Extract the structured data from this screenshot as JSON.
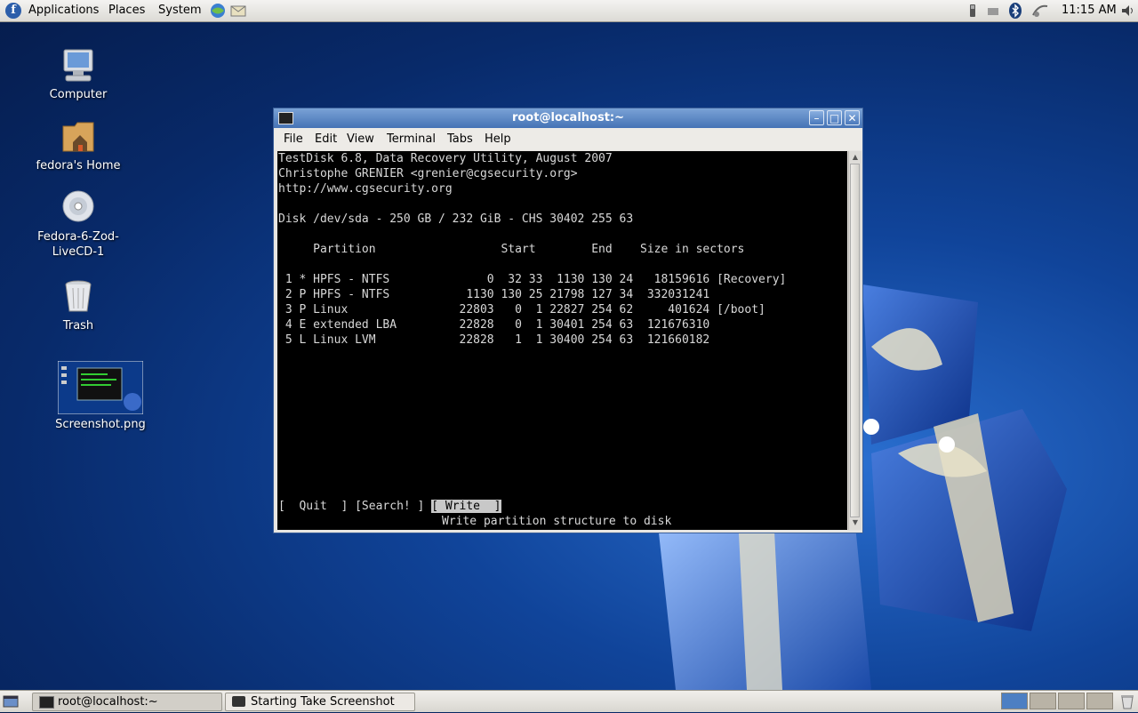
{
  "top_panel": {
    "menus": [
      "Applications",
      "Places",
      "System"
    ],
    "clock": "11:15 AM"
  },
  "desktop_icons": [
    {
      "label": "Computer"
    },
    {
      "label": "fedora's Home"
    },
    {
      "label": "Fedora-6-Zod-LiveCD-1"
    },
    {
      "label": "Trash"
    },
    {
      "label": "Screenshot.png"
    }
  ],
  "window": {
    "title": "root@localhost:~",
    "menu": [
      "File",
      "Edit",
      "View",
      "Terminal",
      "Tabs",
      "Help"
    ]
  },
  "terminal": {
    "line1": "TestDisk 6.8, Data Recovery Utility, August 2007",
    "line2": "Christophe GRENIER <grenier@cgsecurity.org>",
    "line3": "http://www.cgsecurity.org",
    "disk": "Disk /dev/sda - 250 GB / 232 GiB - CHS 30402 255 63",
    "header": "     Partition                  Start        End    Size in sectors",
    "rows": [
      " 1 * HPFS - NTFS              0  32 33  1130 130 24   18159616 [Recovery]",
      " 2 P HPFS - NTFS           1130 130 25 21798 127 34  332031241",
      " 3 P Linux                22803   0  1 22827 254 62     401624 [/boot]",
      " 4 E extended LBA         22828   0  1 30401 254 63  121676310",
      " 5 L Linux LVM            22828   1  1 30400 254 63  121660182"
    ],
    "actions": [
      "[  Quit  ]",
      "[Search! ]",
      "[ Write  ]"
    ],
    "action_hint": "Write partition structure to disk"
  },
  "taskbar": {
    "tasks": [
      "root@localhost:~",
      "Starting Take Screenshot"
    ]
  }
}
